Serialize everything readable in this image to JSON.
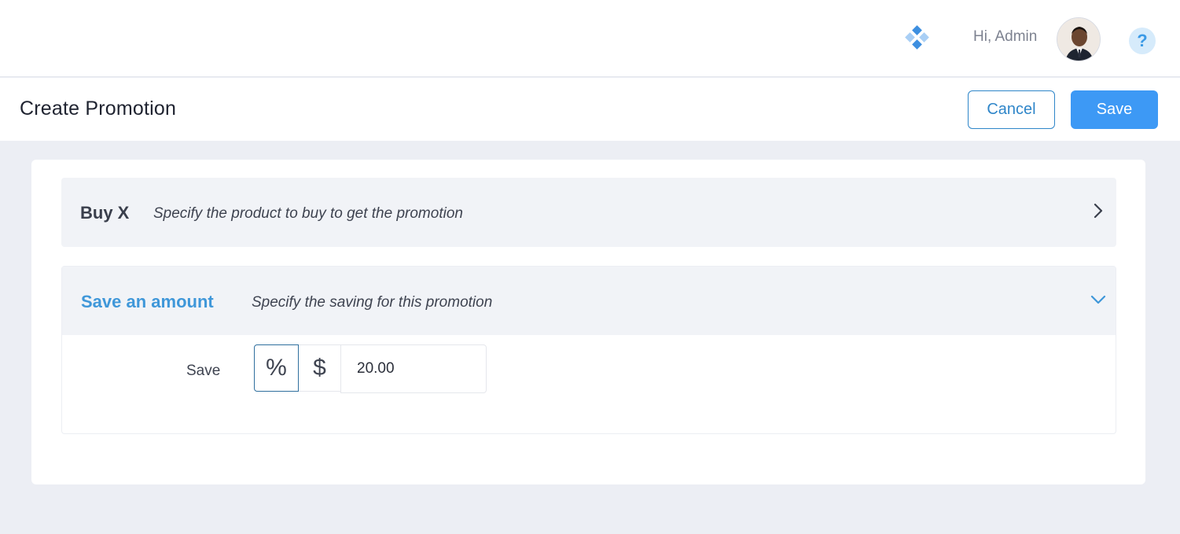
{
  "header": {
    "greeting": "Hi, Admin",
    "help_glyph": "?",
    "apps_icon": "apps-diamond-icon",
    "avatar": "user-avatar-photo"
  },
  "page": {
    "title": "Create Promotion",
    "cancel_label": "Cancel",
    "save_label": "Save"
  },
  "sections": {
    "buy_x": {
      "title": "Buy X",
      "description": "Specify the product to buy to get the promotion",
      "state": "collapsed"
    },
    "save_amount": {
      "title": "Save an amount",
      "description": "Specify the saving for this promotion",
      "state": "expanded",
      "field_label": "Save",
      "type_options": [
        "%",
        "$"
      ],
      "selected_type": "%",
      "amount_value": "20.00"
    }
  },
  "colors": {
    "accent": "#3d99f5",
    "accent_dark": "#2f86c9",
    "section_title_active": "#3f97d9",
    "page_bg": "#eceef4"
  }
}
